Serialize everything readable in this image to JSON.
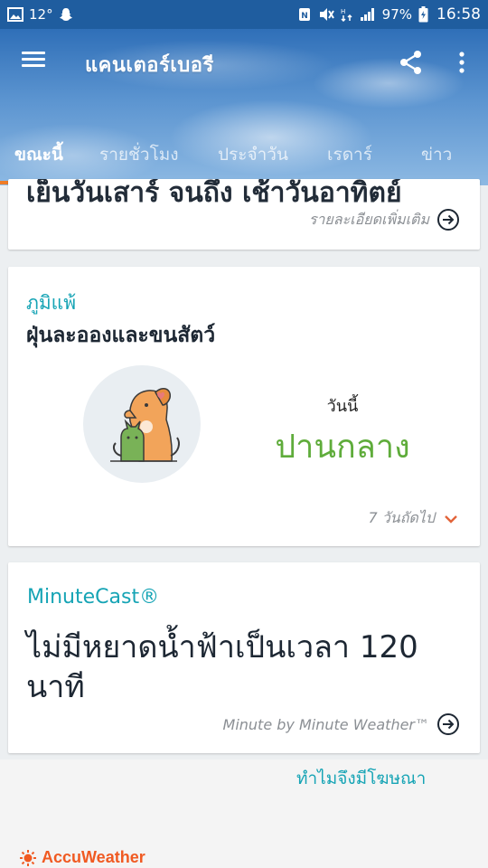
{
  "status_bar": {
    "temperature": "12°",
    "battery_percent": "97%",
    "time": "16:58"
  },
  "header": {
    "title": "แคนเตอร์เบอรี",
    "tabs": [
      {
        "label": "ขณะนี้",
        "active": true
      },
      {
        "label": "รายชั่วโมง",
        "active": false
      },
      {
        "label": "ประจำวัน",
        "active": false
      },
      {
        "label": "เรดาร์",
        "active": false
      },
      {
        "label": "ข่าว",
        "active": false
      }
    ]
  },
  "summary_card": {
    "text": "เย็นวันเสาร์ จนถึง เช้าวันอาทิตย์",
    "detail_link": "รายละเอียดเพิ่มเติม"
  },
  "allergy_card": {
    "type": "ภูมิแพ้",
    "name": "ฝุ่นละอองและขนสัตว์",
    "day": "วันนี้",
    "level": "ปานกลาง",
    "next_days": "7 วันถัดไป"
  },
  "minutecast_card": {
    "title": "MinuteCast®",
    "text": "ไม่มีหยาดน้ำฟ้าเป็นเวลา 120 นาที",
    "detail_link": "Minute by Minute Weather™"
  },
  "ad": {
    "why_ads": "ทำไมจึงมีโฆษณา",
    "brand": "AccuWeather"
  },
  "colors": {
    "accent": "#16a4b5",
    "tab_indicator": "#f07c26",
    "allergy_level": "#5fac3b",
    "brand": "#f05a22"
  }
}
